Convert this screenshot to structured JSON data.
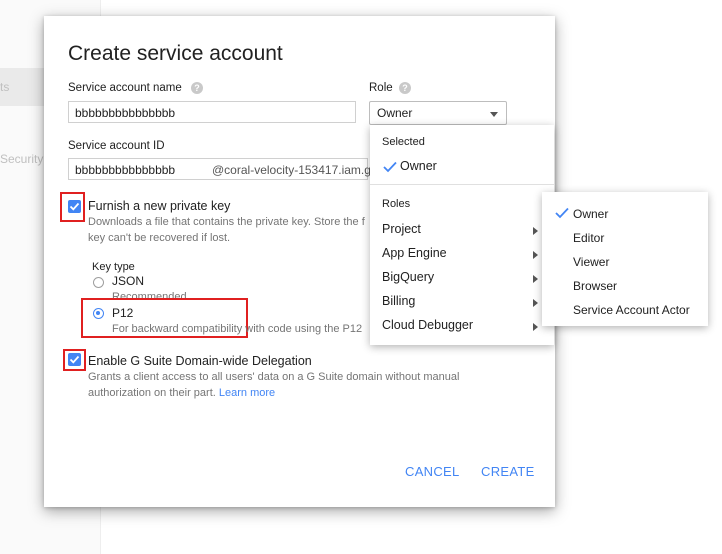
{
  "background": {
    "nav_item_partial": "ts",
    "nav_security_partial": "Security"
  },
  "dialog": {
    "title": "Create service account",
    "name_label": "Service account name",
    "name_value": "bbbbbbbbbbbbbbb",
    "role_label": "Role",
    "role_value": "Owner",
    "id_label": "Service account ID",
    "id_value": "bbbbbbbbbbbbbbb",
    "id_suffix": "@coral-velocity-153417.iam.g",
    "help_glyph": "?",
    "furnish_key": {
      "checked": true,
      "label": "Furnish a new private key",
      "description_line1": "Downloads a file that contains the private key. Store the f",
      "description_line2": "key can't be recovered if lost."
    },
    "key_type": {
      "label": "Key type",
      "options": [
        {
          "label": "JSON",
          "sublabel": "Recommended",
          "selected": false
        },
        {
          "label": "P12",
          "sublabel": "For backward compatibility with code using the P12",
          "selected": true
        }
      ]
    },
    "delegation": {
      "checked": true,
      "label": "Enable G Suite Domain-wide Delegation",
      "description_line1": "Grants a client access to all users' data on a G Suite domain without manual",
      "description_line2": "authorization on their part.",
      "learn_more": "Learn more"
    },
    "cancel_label": "CANCEL",
    "create_label": "CREATE",
    "accent_color": "#4285f4",
    "highlight_color": "#e02020"
  },
  "role_menu": {
    "selected_heading": "Selected",
    "selected_item": "Owner",
    "roles_heading": "Roles",
    "items": [
      "Project",
      "App Engine",
      "BigQuery",
      "Billing",
      "Cloud Debugger"
    ]
  },
  "submenu": {
    "items": [
      {
        "label": "Owner",
        "checked": true
      },
      {
        "label": "Editor",
        "checked": false
      },
      {
        "label": "Viewer",
        "checked": false
      },
      {
        "label": "Browser",
        "checked": false
      },
      {
        "label": "Service Account Actor",
        "checked": false
      }
    ]
  }
}
